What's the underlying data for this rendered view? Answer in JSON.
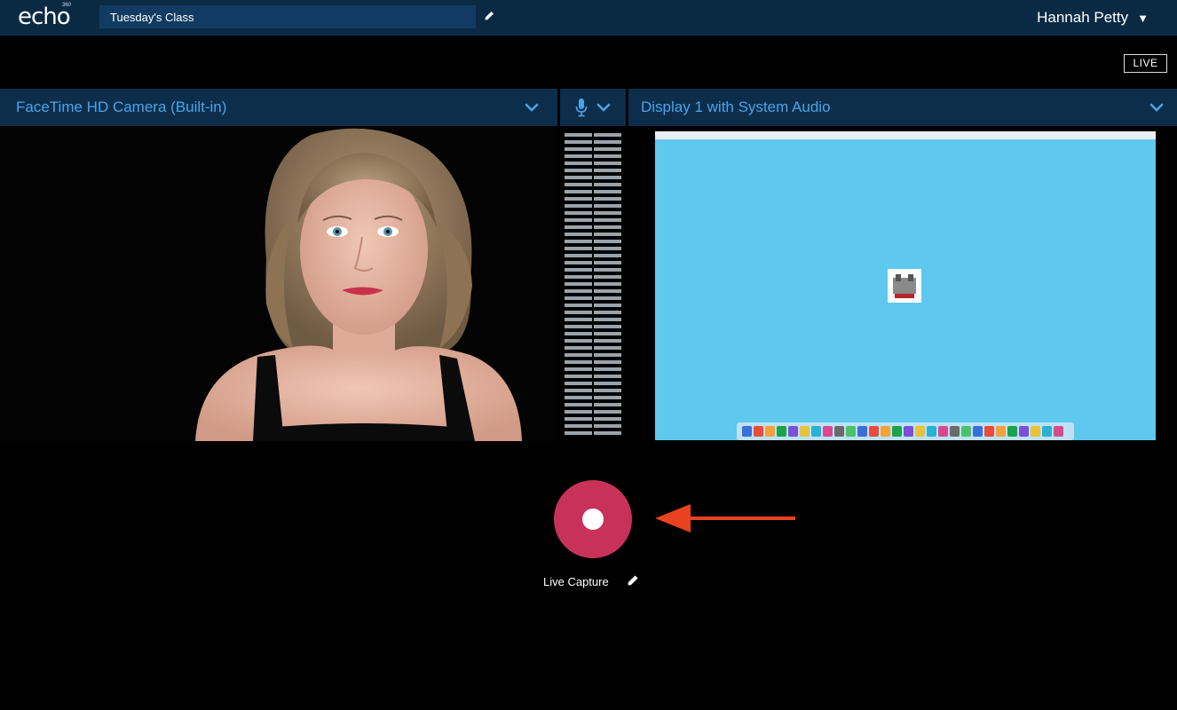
{
  "header": {
    "logo": "echo",
    "logo_sup": "360",
    "title_value": "Tuesday's Class",
    "user_name": "Hannah Petty"
  },
  "status": {
    "live_label": "LIVE"
  },
  "sources": {
    "video": {
      "label": "FaceTime HD Camera (Built-in)"
    },
    "audio": {
      "icon": "microphone-icon"
    },
    "display": {
      "label": "Display 1 with System Audio"
    }
  },
  "capture": {
    "label": "Live Capture"
  },
  "colors": {
    "header_bg": "#0a2a44",
    "source_bar_bg": "#0d2e4b",
    "source_text": "#4aa3e8",
    "record_button": "#c8325a",
    "arrow": "#e8421f",
    "desktop_bg": "#5ec8ee"
  }
}
